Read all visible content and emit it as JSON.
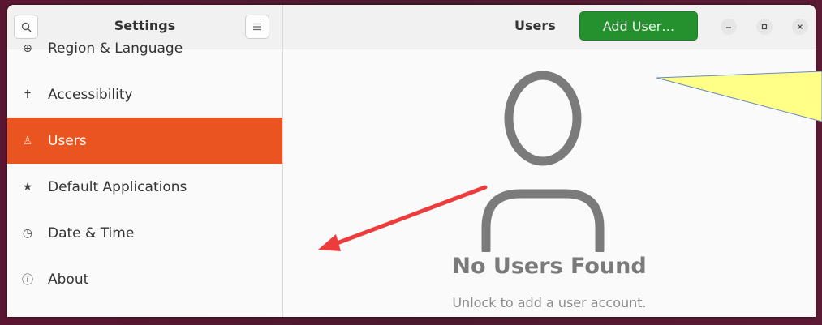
{
  "sidebar": {
    "title": "Settings",
    "search_icon": "search-icon",
    "menu_icon": "hamburger-menu-icon",
    "items": [
      {
        "label": "Region & Language",
        "icon": "globe-icon",
        "glyph": "⊕"
      },
      {
        "label": "Accessibility",
        "icon": "accessibility-icon",
        "glyph": "✝"
      },
      {
        "label": "Users",
        "icon": "user-icon",
        "glyph": "♙",
        "active": true
      },
      {
        "label": "Default Applications",
        "icon": "star-icon",
        "glyph": "★"
      },
      {
        "label": "Date & Time",
        "icon": "clock-icon",
        "glyph": "◷"
      },
      {
        "label": "About",
        "icon": "info-icon",
        "glyph": "ⓘ"
      }
    ]
  },
  "header": {
    "title": "Users",
    "add_button": "Add User…",
    "window_controls": [
      "minimize-icon",
      "maximize-icon",
      "close-icon"
    ]
  },
  "empty_state": {
    "title": "No Users Found",
    "subtitle": "Unlock to add a user account."
  },
  "colors": {
    "accent": "#e95420",
    "add_button": "#24912e",
    "annotation_arrow": "#ee3b3b",
    "annotation_callout": "#ffff88"
  }
}
